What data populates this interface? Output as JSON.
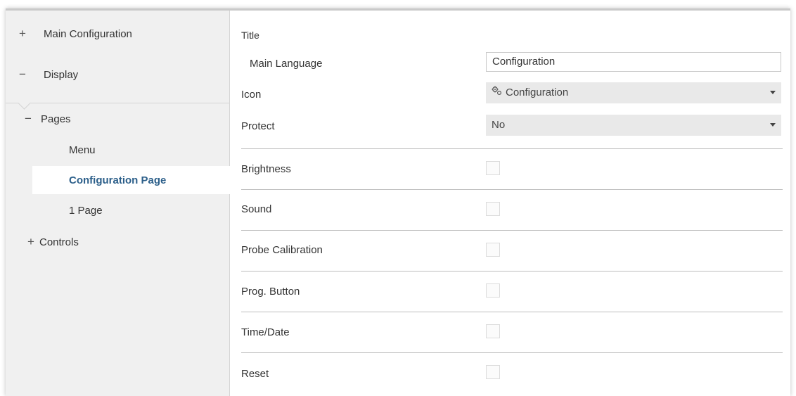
{
  "sidebar": {
    "items": [
      {
        "sign": "+",
        "label": "Main Configuration"
      },
      {
        "sign": "−",
        "label": "Display"
      },
      {
        "sign": "−",
        "label": "Pages"
      },
      {
        "sign": "",
        "label": "Menu"
      },
      {
        "sign": "",
        "label": "Configuration Page"
      },
      {
        "sign": "",
        "label": "1 Page"
      },
      {
        "sign": "+",
        "label": "Controls"
      }
    ]
  },
  "form": {
    "title_label": "Title",
    "main_language_label": "Main Language",
    "main_language_value": "Configuration",
    "icon_label": "Icon",
    "icon_icon": "gears-icon",
    "icon_value": "Configuration",
    "protect_label": "Protect",
    "protect_value": "No",
    "options": [
      {
        "label": "Brightness",
        "checked": false
      },
      {
        "label": "Sound",
        "checked": false
      },
      {
        "label": "Probe Calibration",
        "checked": false
      },
      {
        "label": "Prog. Button",
        "checked": false
      },
      {
        "label": "Time/Date",
        "checked": false
      },
      {
        "label": "Reset",
        "checked": false
      }
    ]
  },
  "colors": {
    "sidebar_bg": "#f0f0f0",
    "selected_text": "#2c5f8a",
    "select_bg": "#e9e9e9"
  }
}
